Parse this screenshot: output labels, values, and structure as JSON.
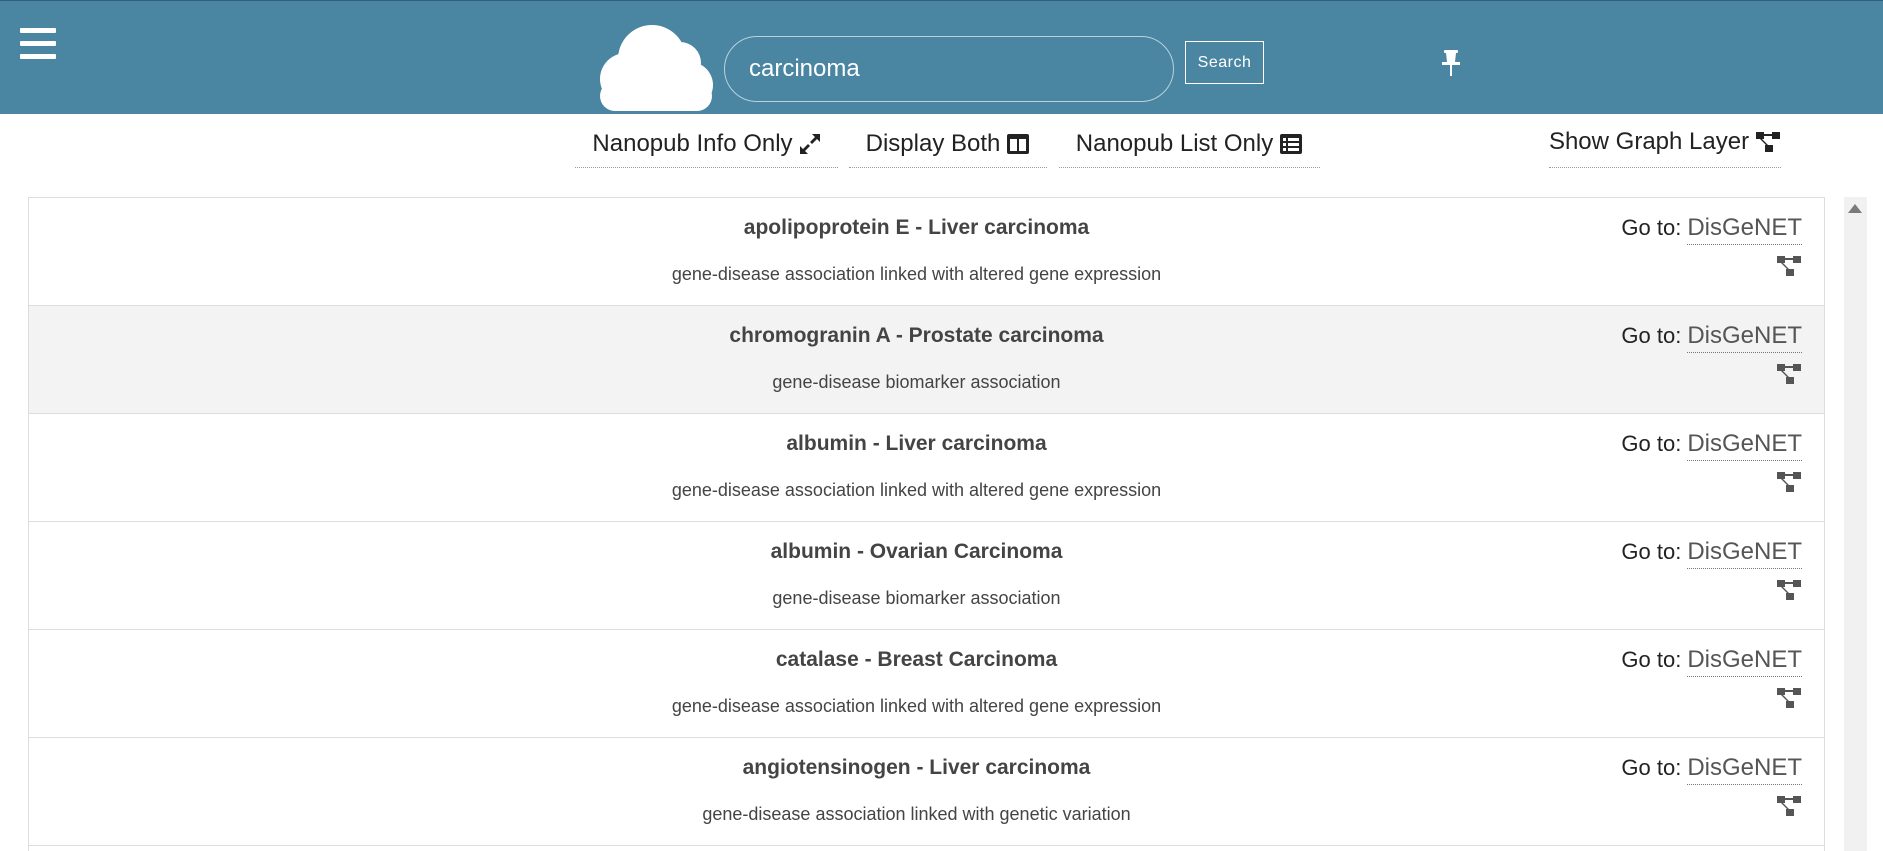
{
  "header": {
    "search": {
      "value": "carcinoma",
      "button_label": "Search"
    },
    "icons": {
      "menu": "hamburger-menu-icon",
      "logo": "cloud-logo-icon",
      "pin": "pin-icon"
    },
    "colors": {
      "bar": "#4a85a1",
      "text": "#ffffff"
    }
  },
  "toolbar": {
    "info_only": "Nanopub Info Only",
    "display_both": "Display Both",
    "list_only": "Nanopub List Only",
    "show_graph": "Show Graph Layer"
  },
  "results": [
    {
      "title": "apolipoprotein E - Liver carcinoma",
      "subtitle": "gene-disease association linked with altered gene expression",
      "goto_label": "Go to:",
      "goto_link": "DisGeNET"
    },
    {
      "title": "chromogranin A - Prostate carcinoma",
      "subtitle": "gene-disease biomarker association",
      "goto_label": "Go to:",
      "goto_link": "DisGeNET"
    },
    {
      "title": "albumin - Liver carcinoma",
      "subtitle": "gene-disease association linked with altered gene expression",
      "goto_label": "Go to:",
      "goto_link": "DisGeNET"
    },
    {
      "title": "albumin - Ovarian Carcinoma",
      "subtitle": "gene-disease biomarker association",
      "goto_label": "Go to:",
      "goto_link": "DisGeNET"
    },
    {
      "title": "catalase - Breast Carcinoma",
      "subtitle": "gene-disease association linked with altered gene expression",
      "goto_label": "Go to:",
      "goto_link": "DisGeNET"
    },
    {
      "title": "angiotensinogen - Liver carcinoma",
      "subtitle": "gene-disease association linked with genetic variation",
      "goto_label": "Go to:",
      "goto_link": "DisGeNET"
    }
  ]
}
